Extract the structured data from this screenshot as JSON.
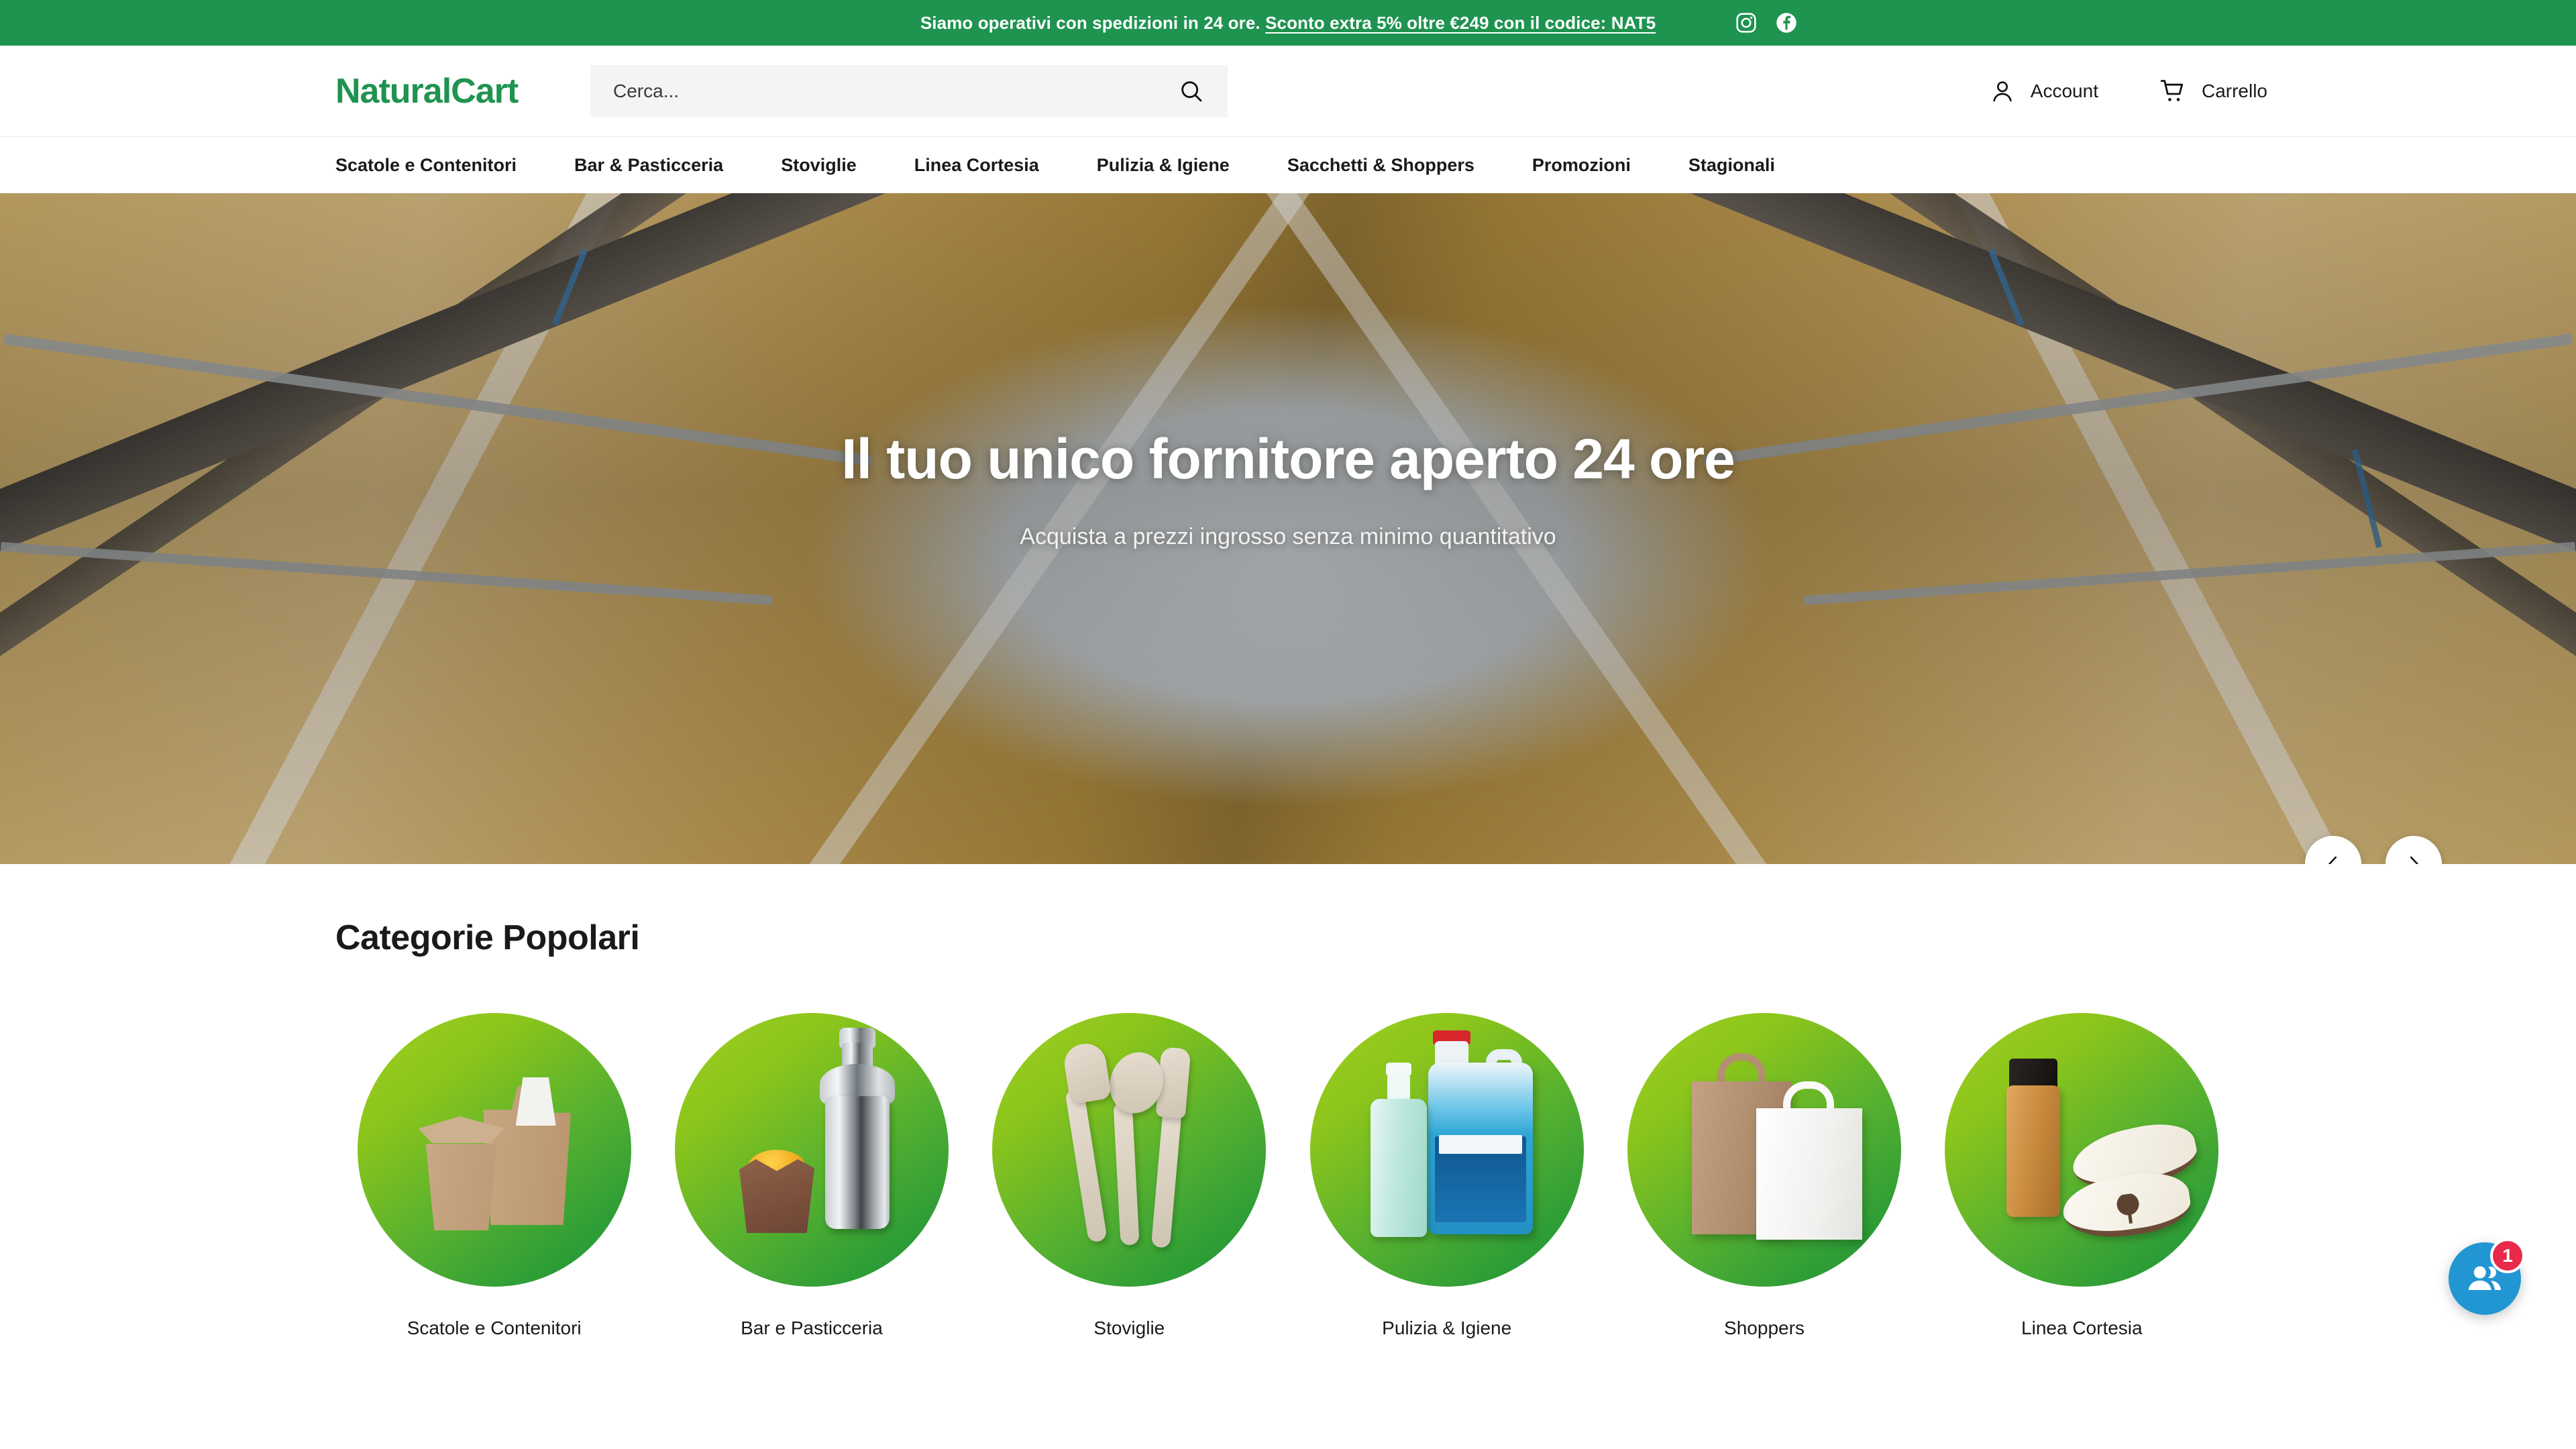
{
  "announcement": {
    "text_before": "Siamo operativi con spedizioni in 24 ore. ",
    "link_text": "Sconto extra 5% oltre €249 con il codice: NAT5",
    "background_color": "#1f9350",
    "social": [
      {
        "name": "instagram-icon",
        "label": "Instagram"
      },
      {
        "name": "facebook-icon",
        "label": "Facebook"
      }
    ]
  },
  "header": {
    "logo_text": "NaturalCart",
    "logo_color": "#1f9350",
    "search": {
      "placeholder": "Cerca...",
      "value": "",
      "icon": "search-icon"
    },
    "account_label": "Account",
    "cart_label": "Carrello"
  },
  "nav": {
    "items": [
      {
        "label": "Scatole e Contenitori"
      },
      {
        "label": "Bar & Pasticceria"
      },
      {
        "label": "Stoviglie"
      },
      {
        "label": "Linea Cortesia"
      },
      {
        "label": "Pulizia & Igiene"
      },
      {
        "label": "Sacchetti & Shoppers"
      },
      {
        "label": "Promozioni"
      },
      {
        "label": "Stagionali"
      }
    ]
  },
  "hero": {
    "title": "Il tuo unico fornitore aperto 24 ore",
    "subtitle": "Acquista a prezzi ingrosso senza minimo quantitativo",
    "prev_label": "‹",
    "next_label": "›"
  },
  "categories": {
    "title": "Categorie Popolari",
    "items": [
      {
        "label": "Scatole e Contenitori",
        "art": "kraft-containers"
      },
      {
        "label": "Bar e Pasticceria",
        "art": "shaker-muffin"
      },
      {
        "label": "Stoviglie",
        "art": "wooden-cutlery"
      },
      {
        "label": "Pulizia & Igiene",
        "art": "cleaning-products"
      },
      {
        "label": "Shoppers",
        "art": "paper-bags"
      },
      {
        "label": "Linea Cortesia",
        "art": "amenities-slippers"
      }
    ],
    "circle_gradient_from": "#a0cf22",
    "circle_gradient_to": "#1f9338"
  },
  "chat_widget": {
    "badge_count": "1",
    "icon": "people-chat-icon",
    "color": "#2196d3",
    "badge_color": "#e8294a"
  }
}
